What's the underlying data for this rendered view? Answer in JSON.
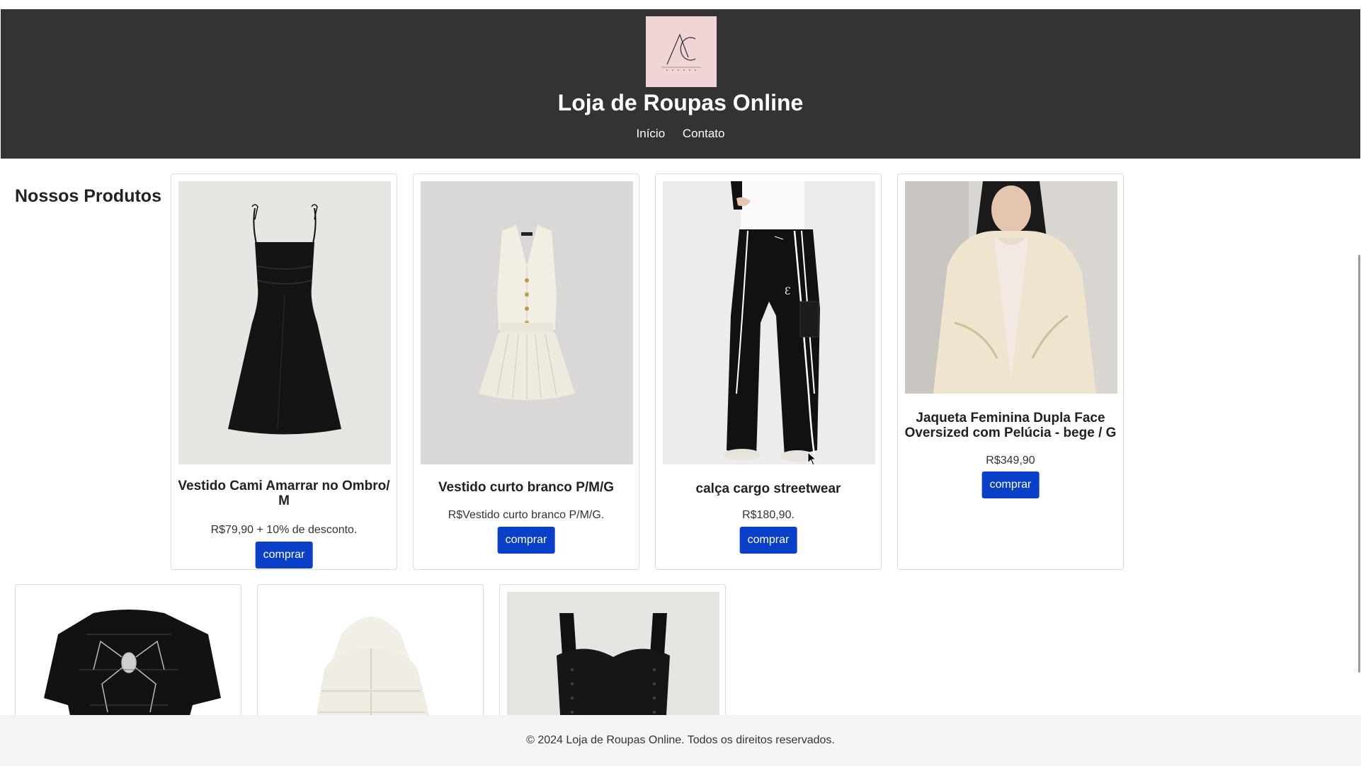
{
  "header": {
    "logo_icon": "ac-closet-logo",
    "title": "Loja de Roupas Online",
    "nav": [
      {
        "label": "Início"
      },
      {
        "label": "Contato"
      }
    ]
  },
  "main": {
    "section_title": "Nossos Produtos",
    "products": [
      {
        "name": "Vestido Cami Amarrar no Ombro/ M",
        "price": "R$79,90 + 10% de desconto.",
        "button": "comprar",
        "image": "black-satin-dress"
      },
      {
        "name": "Vestido curto branco P/M/G",
        "price": "R$Vestido curto branco P/M/G.",
        "button": "comprar",
        "image": "white-vest-dress"
      },
      {
        "name": "calça cargo streetwear",
        "price": "R$180,90.",
        "button": "comprar",
        "image": "black-cargo-pants"
      },
      {
        "name": "Jaqueta Feminina Dupla Face Oversized com Pelúcia - bege / G",
        "price": "R$349,90",
        "button": "comprar",
        "image": "beige-plush-jacket"
      },
      {
        "image": "black-spider-tshirt"
      },
      {
        "image": "white-puffer-jacket"
      },
      {
        "image": "black-corset-top"
      }
    ]
  },
  "footer": {
    "text": "© 2024 Loja de Roupas Online. Todos os direitos reservados."
  },
  "colors": {
    "header_bg": "#333333",
    "button_bg": "#0a3fc7",
    "footer_bg": "#f4f4f4",
    "logo_bg": "#f1d4d6"
  }
}
